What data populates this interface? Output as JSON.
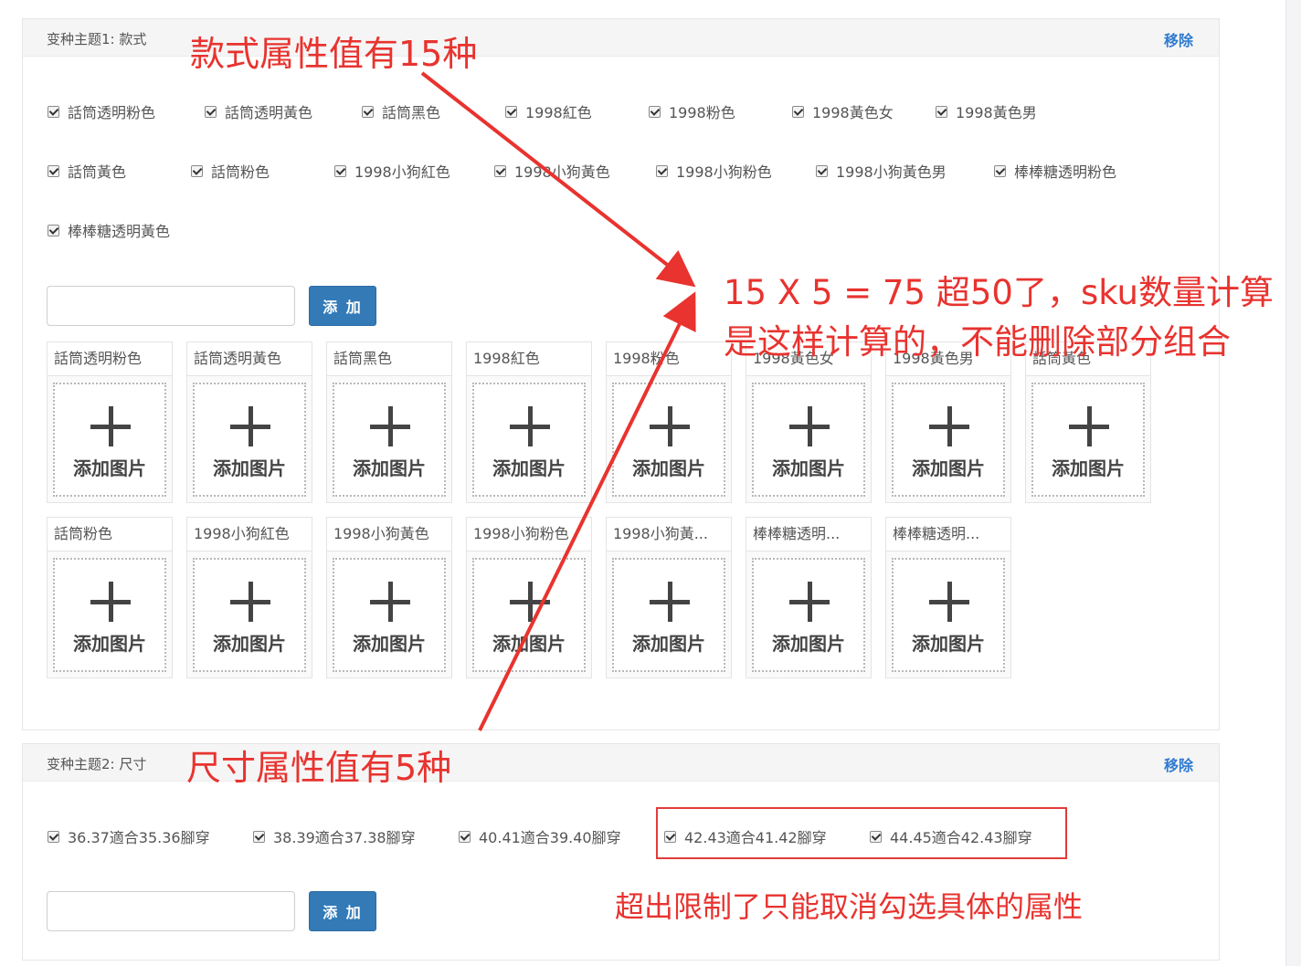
{
  "variant1": {
    "theme_label": "变种主题1:  款式",
    "remove": "移除",
    "checkboxes": [
      "話筒透明粉色",
      "話筒透明黃色",
      "話筒黑色",
      "1998紅色",
      "1998粉色",
      "1998黃色女",
      "1998黃色男",
      "話筒黃色",
      "話筒粉色",
      "1998小狗紅色",
      "1998小狗黃色",
      "1998小狗粉色",
      "1998小狗黃色男",
      "棒棒糖透明粉色",
      "棒棒糖透明黃色"
    ],
    "add_button": "添 加",
    "cards": [
      "話筒透明粉色",
      "話筒透明黃色",
      "話筒黑色",
      "1998紅色",
      "1998粉色",
      "1998黃色女",
      "1998黃色男",
      "話筒黃色",
      "話筒粉色",
      "1998小狗紅色",
      "1998小狗黃色",
      "1998小狗粉色",
      "1998小狗黃...",
      "棒棒糖透明...",
      "棒棒糖透明..."
    ],
    "upload_label": "添加图片"
  },
  "variant2": {
    "theme_label": "变种主题2:  尺寸",
    "remove": "移除",
    "checkboxes": [
      "36.37適合35.36腳穿",
      "38.39適合37.38腳穿",
      "40.41適合39.40腳穿",
      "42.43適合41.42腳穿",
      "44.45適合42.43腳穿"
    ],
    "add_button": "添 加"
  },
  "annotations": {
    "style_count": "款式属性值有15种",
    "calc_line1": "15 X 5 = 75 超50了，sku数量计算",
    "calc_line2": "是这样计算的，不能删除部分组合",
    "size_count": "尺寸属性值有5种",
    "limit_note": "超出限制了只能取消勾选具体的属性"
  },
  "colors": {
    "annotation_red": "#e8332f",
    "button_blue": "#337ab7",
    "link_blue": "#2f7bd0"
  }
}
